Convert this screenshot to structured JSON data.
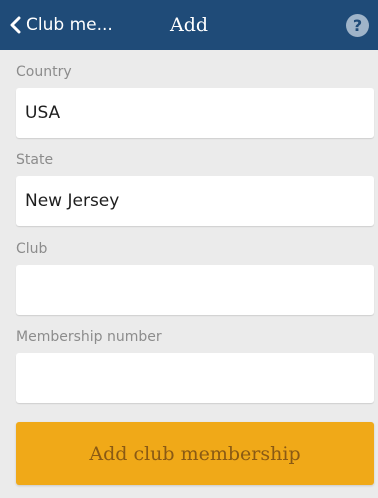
{
  "header": {
    "back_label": "Club me...",
    "title": "Add",
    "help_symbol": "?"
  },
  "form": {
    "country": {
      "label": "Country",
      "value": "USA"
    },
    "state": {
      "label": "State",
      "value": "New Jersey"
    },
    "club": {
      "label": "Club",
      "value": ""
    },
    "membership": {
      "label": "Membership number",
      "value": ""
    }
  },
  "submit_label": "Add club membership",
  "colors": {
    "header_bg": "#1f4b78",
    "page_bg": "#ebebeb",
    "button_bg": "#f0a918",
    "button_text": "#8a5a14"
  }
}
